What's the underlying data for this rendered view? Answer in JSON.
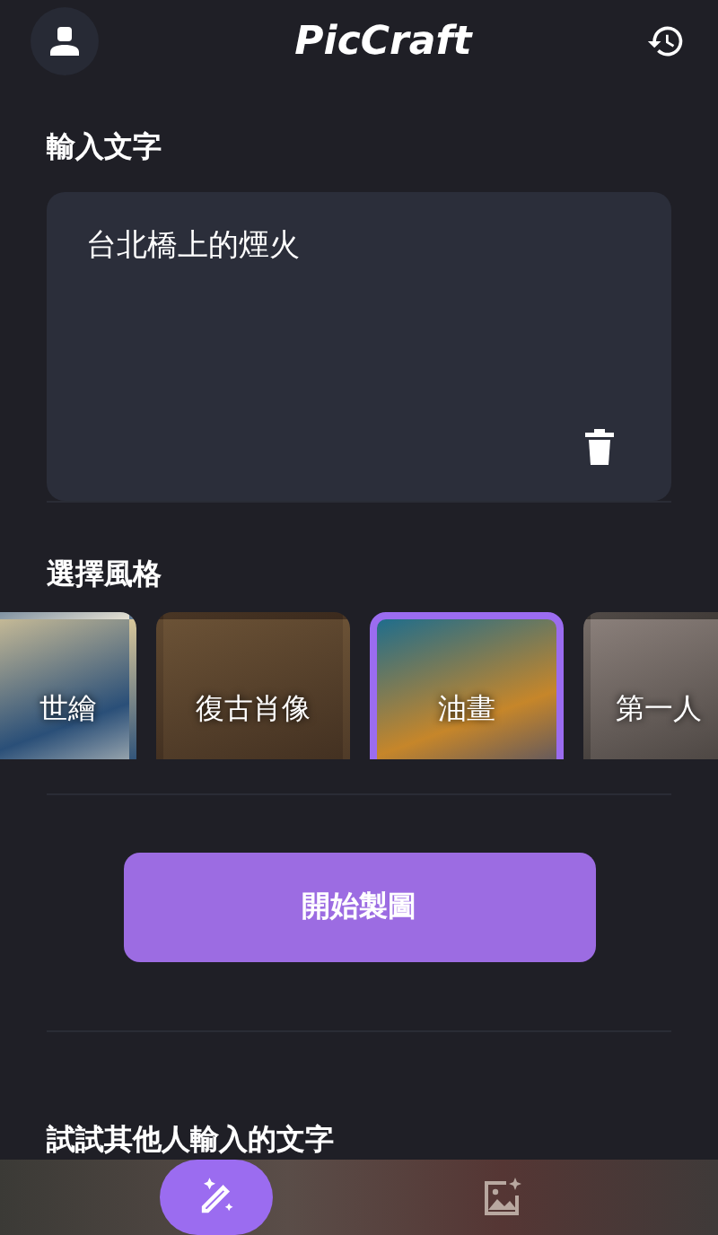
{
  "header": {
    "title": "PicCraft"
  },
  "input_section": {
    "heading": "輸入文字",
    "value": "台北橋上的煙火"
  },
  "style_section": {
    "heading": "選擇風格",
    "styles": [
      {
        "label": "世繪",
        "selected": false
      },
      {
        "label": "復古肖像",
        "selected": false
      },
      {
        "label": "油畫",
        "selected": true
      },
      {
        "label": "第一人",
        "selected": false
      }
    ]
  },
  "generate_button": "開始製圖",
  "others_heading": "試試其他人輸入的文字",
  "nav": [
    {
      "kind": "create",
      "selected": true
    },
    {
      "kind": "gallery",
      "selected": false
    }
  ]
}
